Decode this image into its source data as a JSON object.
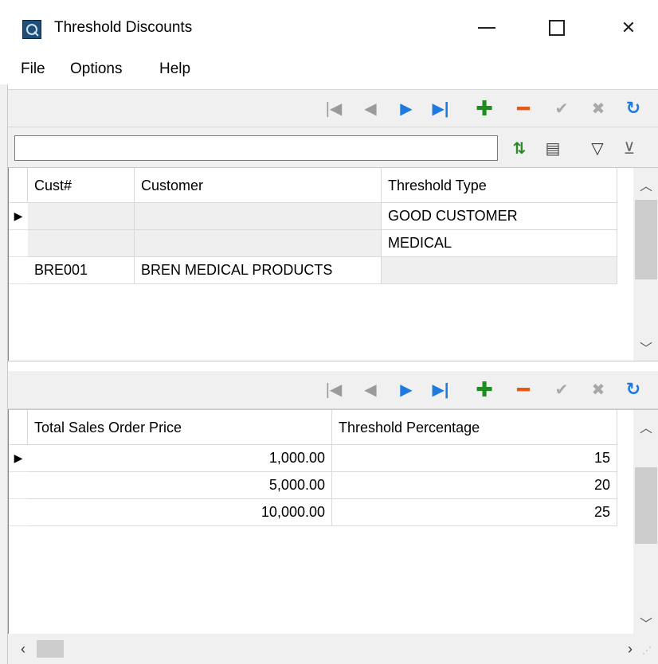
{
  "window": {
    "title": "Threshold Discounts",
    "icon": "app-logo-icon",
    "controls": {
      "minimize": "minimize-icon",
      "maximize": "maximize-icon",
      "close": "close-icon"
    }
  },
  "menu": {
    "file": "File",
    "options": "Options",
    "help": "Help"
  },
  "nav_icons": [
    "first-record-icon",
    "prev-record-icon",
    "next-record-icon",
    "last-record-icon",
    "add-record-icon",
    "delete-record-icon",
    "post-edit-icon",
    "cancel-edit-icon",
    "refresh-icon"
  ],
  "search": {
    "value": "",
    "placeholder": ""
  },
  "search_tools": [
    "sort-icon",
    "grid-columns-icon",
    "filter-icon",
    "clear-filter-icon"
  ],
  "grid_thresholds": {
    "columns": [
      "Cust#",
      "Customer",
      "Threshold Type"
    ],
    "rows": [
      {
        "cust": "",
        "customer": "",
        "threshold_type": "GOOD CUSTOMER",
        "current": true
      },
      {
        "cust": "",
        "customer": "",
        "threshold_type": "MEDICAL",
        "current": false
      },
      {
        "cust": "BRE001",
        "customer": "BREN MEDICAL PRODUCTS",
        "threshold_type": "",
        "current": false
      }
    ]
  },
  "grid_percentages": {
    "columns": [
      "Total Sales Order Price",
      "Threshold Percentage"
    ],
    "rows": [
      {
        "price": "1,000.00",
        "percentage": "15",
        "current": true
      },
      {
        "price": "5,000.00",
        "percentage": "20",
        "current": false
      },
      {
        "price": "10,000.00",
        "percentage": "25",
        "current": false
      }
    ]
  },
  "colors": {
    "nav_active": "#1f7ae0",
    "add": "#1e8c1e",
    "delete": "#e05a1a",
    "disabled": "#a8a8a8",
    "sort": "#2a8a2a"
  }
}
